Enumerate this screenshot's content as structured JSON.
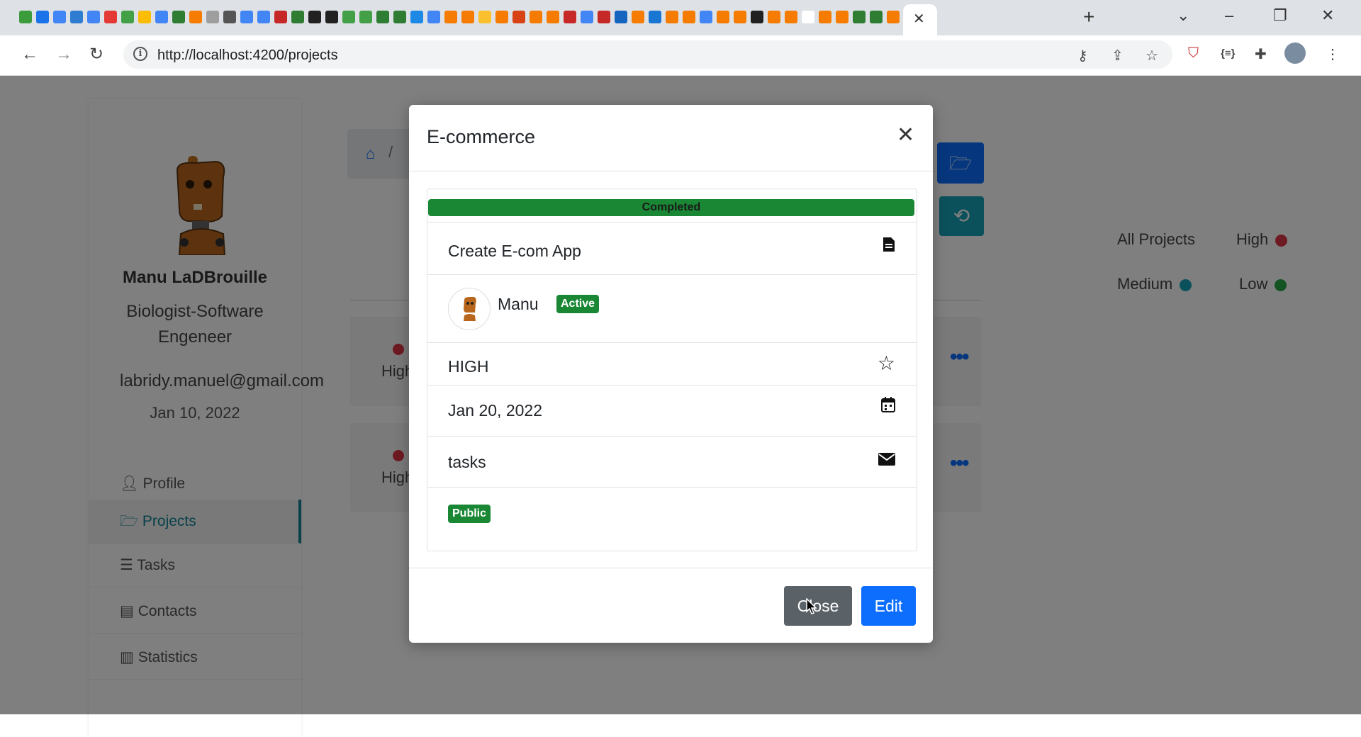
{
  "browser": {
    "url": "http://localhost:4200/projects",
    "tab_close": "✕",
    "new_tab": "+",
    "favicon_colors": [
      "#3c9c3c",
      "#1a73e8",
      "#4285f4",
      "#2e7dd1",
      "#4285f4",
      "#e53935",
      "#43a047",
      "#fbbc04",
      "#4285f4",
      "#2e7d32",
      "#f57c00",
      "#9e9e9e",
      "#555555",
      "#4285f4",
      "#4285f4",
      "#c62828",
      "#2e7d32",
      "#212121",
      "#212121",
      "#43a047",
      "#43a047",
      "#2e7d32",
      "#2e7d32",
      "#1e88e5",
      "#4285f4",
      "#f57c00",
      "#f57c00",
      "#fbc02d",
      "#f57c00",
      "#d84315",
      "#f57c00",
      "#f57c00",
      "#c62828",
      "#4285f4",
      "#c62828",
      "#1565c0",
      "#f57c00",
      "#1976d2",
      "#f57c00",
      "#f57c00",
      "#4285f4",
      "#f57c00",
      "#f57c00",
      "#212121",
      "#f57c00",
      "#f57c00",
      "#ffffff",
      "#f57c00",
      "#f57c00",
      "#2e7d32",
      "#2e7d32",
      "#f57c00",
      "#e53935",
      "#424242",
      "#43a047"
    ]
  },
  "sidebar": {
    "name": "Manu LaDBrouille",
    "title_line1": "Biologist-Software",
    "title_line2": "Engeneer",
    "email": "labridy.manuel@gmail.com",
    "date": "Jan 10, 2022",
    "items": [
      {
        "label": "Profile",
        "icon": "user-icon"
      },
      {
        "label": "Projects",
        "icon": "folder-open-icon"
      },
      {
        "label": "Tasks",
        "icon": "list-check-icon"
      },
      {
        "label": "Contacts",
        "icon": "address-book-icon"
      },
      {
        "label": "Statistics",
        "icon": "bar-chart-icon"
      }
    ]
  },
  "breadcrumb": {
    "sep": "/"
  },
  "rows": [
    {
      "priority": "High"
    },
    {
      "priority": "High"
    }
  ],
  "legend": [
    {
      "label": "All Projects"
    },
    {
      "label": "High",
      "color": "#dc3545"
    },
    {
      "label": "Medium",
      "color": "#17a2b8"
    },
    {
      "label": "Low",
      "color": "#28a745"
    }
  ],
  "modal": {
    "title": "E-commerce",
    "status": "Completed",
    "status_progress_percent": 100,
    "description": "Create E-com App",
    "owner": "Manu",
    "owner_badge": "Active",
    "priority": "HIGH",
    "due_date": "Jan 20, 2022",
    "category": "tasks",
    "visibility": "Public",
    "close_button": "Close",
    "edit_button": "Edit"
  },
  "colors": {
    "primary": "#0d6efd",
    "success": "#198734",
    "info": "#17a2b8",
    "secondary": "#5a6268",
    "danger": "#dc3545"
  }
}
